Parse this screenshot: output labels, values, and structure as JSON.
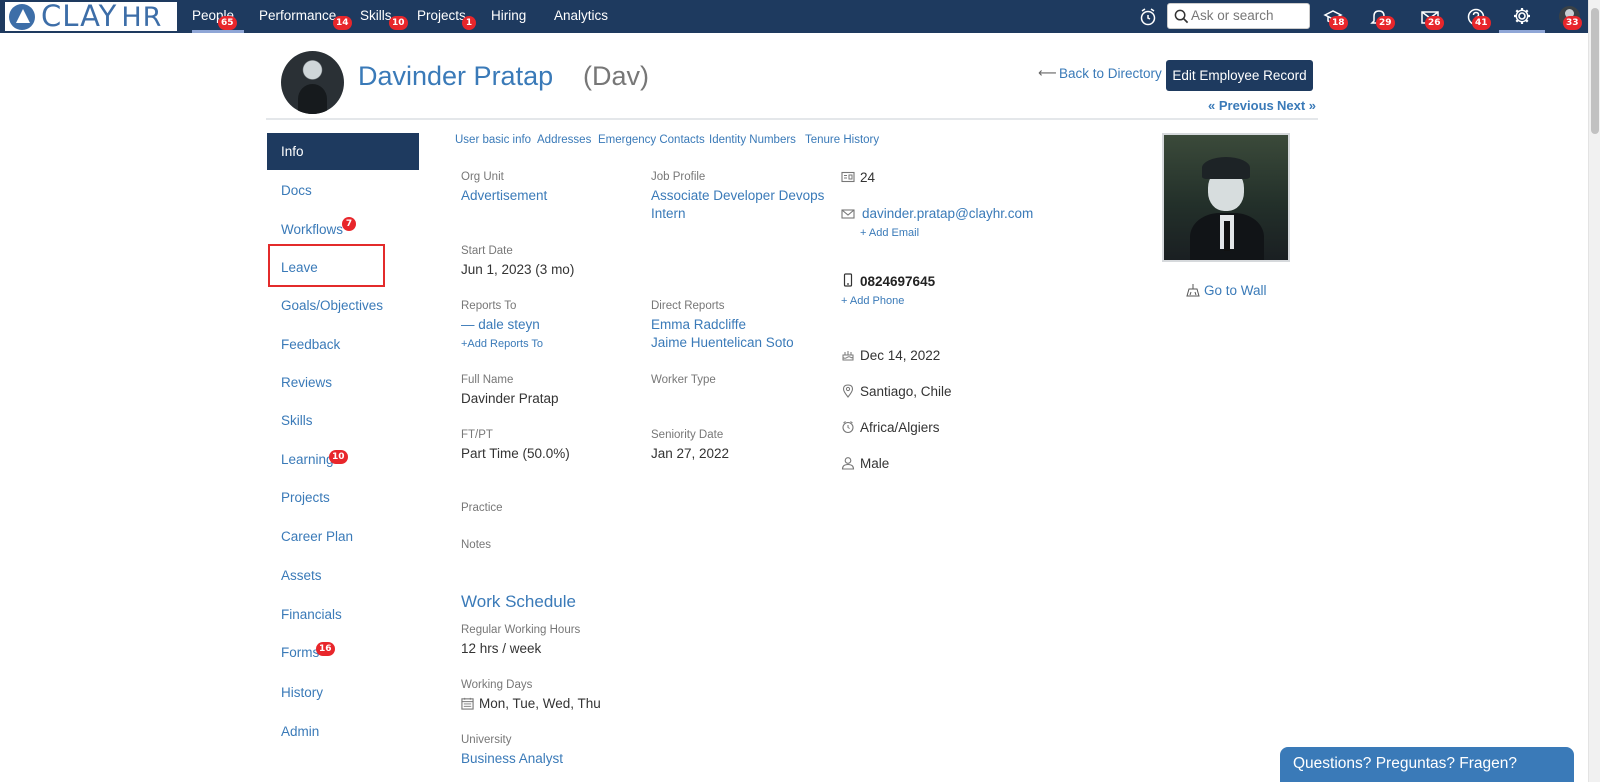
{
  "brand": {
    "name": "CLAY",
    "suffix": "HR"
  },
  "nav": {
    "items": [
      {
        "label": "People",
        "badge": "65"
      },
      {
        "label": "Performance",
        "badge": "14"
      },
      {
        "label": "Skills",
        "badge": "10"
      },
      {
        "label": "Projects",
        "badge": "1"
      },
      {
        "label": "Hiring"
      },
      {
        "label": "Analytics"
      }
    ],
    "search_placeholder": "Ask or search",
    "icon_badges": {
      "learning": "18",
      "notifications": "29",
      "messages": "26",
      "help": "41",
      "profile": "33"
    }
  },
  "header": {
    "name": "Davinder Pratap",
    "nickname": "(Dav)",
    "back_label": "Back to Directory",
    "edit_label": "Edit Employee Record",
    "prev_label": "« Previous",
    "next_label": "Next »"
  },
  "menu": {
    "active": "Info",
    "items": [
      {
        "label": "Docs"
      },
      {
        "label": "Workflows",
        "badge": "7"
      },
      {
        "label": "Leave"
      },
      {
        "label": "Goals/Objectives"
      },
      {
        "label": "Feedback"
      },
      {
        "label": "Reviews"
      },
      {
        "label": "Skills"
      },
      {
        "label": "Learning",
        "badge": "10"
      },
      {
        "label": "Projects"
      },
      {
        "label": "Career Plan"
      },
      {
        "label": "Assets"
      },
      {
        "label": "Financials"
      },
      {
        "label": "Forms",
        "badge": "16"
      },
      {
        "label": "History"
      },
      {
        "label": "Admin"
      }
    ]
  },
  "subtabs": [
    "User basic info",
    "Addresses",
    "Emergency Contacts",
    "Identity Numbers",
    "Tenure History"
  ],
  "info": {
    "org_unit_label": "Org Unit",
    "org_unit": "Advertisement",
    "job_profile_label": "Job Profile",
    "job_profile_1": "Associate Developer Devops",
    "job_profile_2": "Intern",
    "start_date_label": "Start Date",
    "start_date": "Jun 1, 2023 (3 mo)",
    "reports_to_label": "Reports To",
    "reports_to": "— dale steyn",
    "add_reports_to": "+Add Reports To",
    "direct_reports_label": "Direct Reports",
    "direct_reports": [
      "Emma Radcliffe",
      "Jaime Huentelican Soto"
    ],
    "full_name_label": "Full Name",
    "full_name": "Davinder Pratap",
    "worker_type_label": "Worker Type",
    "ftpt_label": "FT/PT",
    "ftpt": "Part Time (50.0%)",
    "seniority_label": "Seniority Date",
    "seniority": "Jan 27, 2022",
    "practice_label": "Practice",
    "notes_label": "Notes",
    "work_schedule_title": "Work Schedule",
    "hours_label": "Regular Working Hours",
    "hours": "12 hrs / week",
    "days_label": "Working Days",
    "days": "Mon, Tue, Wed, Thu",
    "university_label": "University",
    "university": "Business Analyst"
  },
  "contact": {
    "id": "24",
    "email": "davinder.pratap@clayhr.com",
    "add_email": "+ Add Email",
    "phone": "0824697645",
    "add_phone": "+ Add Phone",
    "birthday": "Dec 14, 2022",
    "location": "Santiago, Chile",
    "timezone": "Africa/Algiers",
    "gender": "Male"
  },
  "wall_label": "Go to Wall",
  "chat_label": "Questions? Preguntas? Fragen?"
}
